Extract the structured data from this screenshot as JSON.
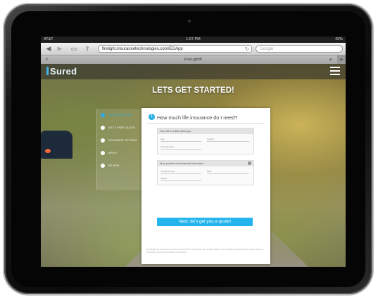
{
  "statusbar": {
    "carrier": "AT&T",
    "time": "1:57 PM",
    "battery": "43%"
  },
  "browser": {
    "url": "firelight.insurancetechnologies.com/EGApp",
    "search_placeholder": "Google",
    "tab_title": "FireLight®"
  },
  "site": {
    "logo": "Sured",
    "headline": "LETS GET STARTED!"
  },
  "steps": [
    {
      "label": "NEEDS ANALYSIS"
    },
    {
      "label": "GET A FREE QUOTE"
    },
    {
      "label": "COVERAGE OPTIONS"
    },
    {
      "label": "APPLY"
    },
    {
      "label": "REVIEW"
    }
  ],
  "form": {
    "step_number": "1",
    "question": "How much life insurance do I need?",
    "section1": {
      "header": "First, tell us a little about you",
      "fields": [
        "Age",
        "Gender",
        "Coverage Amt"
      ]
    },
    "section2": {
      "header": "Now, provide some financial information",
      "info": "i",
      "fields": [
        "Annual Income",
        "Debt",
        "Assets"
      ]
    },
    "cta": "Next, let's get you a quote!",
    "fine_print": "By clicking Next you agree to our terms and conditions. Rates shown are estimates based on the information provided and may change based on underwriting review and verification of information."
  }
}
